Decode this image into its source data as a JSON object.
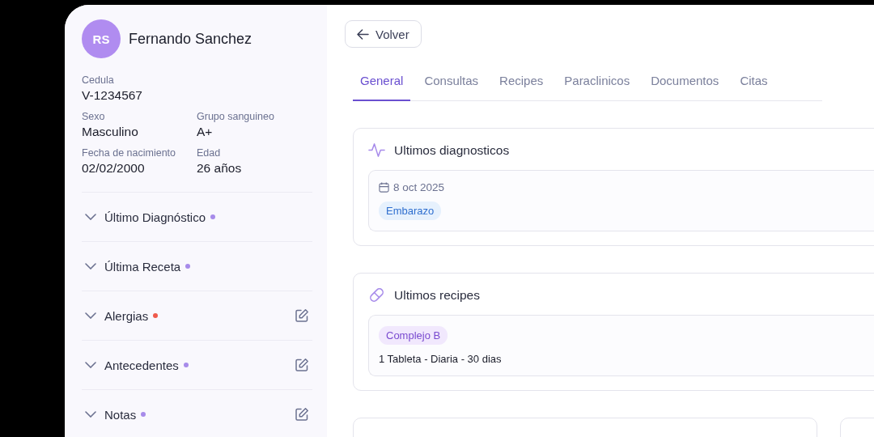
{
  "patient": {
    "initials": "RS",
    "name": "Fernando Sanchez"
  },
  "fields": [
    {
      "label": "Cedula",
      "value": "V-1234567",
      "full": true
    },
    {
      "label": "Sexo",
      "value": "Masculino",
      "full": false
    },
    {
      "label": "Grupo sanguineo",
      "value": "A+",
      "full": false
    },
    {
      "label": "Fecha de nacimiento",
      "value": "02/02/2000",
      "full": false
    },
    {
      "label": "Edad",
      "value": "26 años",
      "full": false
    }
  ],
  "sections": [
    {
      "label": "Último Diagnóstico",
      "color": "#a78bea",
      "editable": false
    },
    {
      "label": "Última Receta",
      "color": "#a78bea",
      "editable": false
    },
    {
      "label": "Alergias",
      "color": "#ef5a4c",
      "editable": true
    },
    {
      "label": "Antecedentes",
      "color": "#a78bea",
      "editable": true
    },
    {
      "label": "Notas",
      "color": "#a78bea",
      "editable": true
    }
  ],
  "back_button": "Volver",
  "tabs": [
    {
      "label": "General",
      "selected": true
    },
    {
      "label": "Consultas",
      "selected": false
    },
    {
      "label": "Recipes",
      "selected": false
    },
    {
      "label": "Paraclinicos",
      "selected": false
    },
    {
      "label": "Documentos",
      "selected": false
    },
    {
      "label": "Citas",
      "selected": false
    }
  ],
  "cards": [
    {
      "kind": "diagnoses",
      "title": "Ultimos diagnosticos",
      "entries": [
        {
          "date": "8 oct 2025",
          "tag": "Embarazo"
        }
      ]
    },
    {
      "kind": "prescriptions",
      "title": "Ultimos recipes",
      "entries": [
        {
          "tag": "Complejo B",
          "detail": "1 Tableta - Diaria - 30 dias"
        }
      ]
    }
  ]
}
